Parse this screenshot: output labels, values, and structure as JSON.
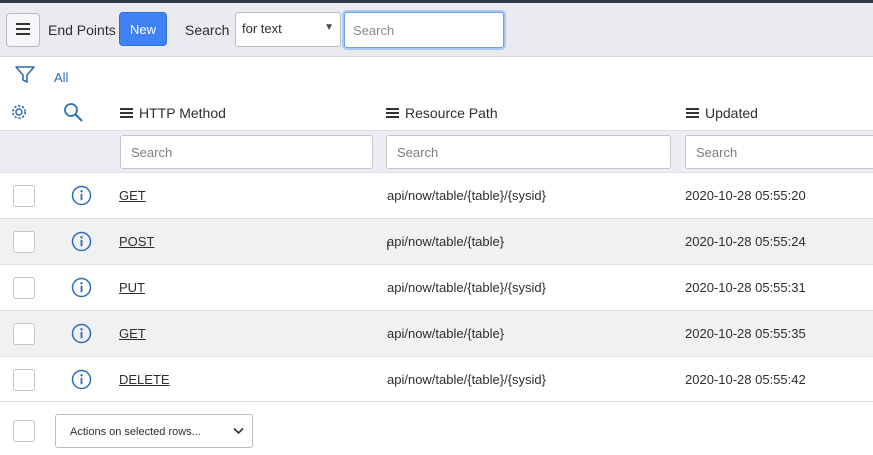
{
  "header": {
    "title": "End Points",
    "new_label": "New",
    "search_label": "Search",
    "search_field": {
      "selected": "for text"
    },
    "search_input": {
      "placeholder": "Search",
      "value": ""
    }
  },
  "filter": {
    "breadcrumb": "All"
  },
  "columns": [
    {
      "label": "HTTP Method",
      "search_placeholder": "Search"
    },
    {
      "label": "Resource Path",
      "search_placeholder": "Search"
    },
    {
      "label": "Updated",
      "search_placeholder": "Search"
    }
  ],
  "rows": [
    {
      "method": "GET",
      "path": "api/now/table/{table}/{sysid}",
      "updated": "2020-10-28 05:55:20"
    },
    {
      "method": "POST",
      "path": "api/now/table/{table}",
      "updated": "2020-10-28 05:55:24"
    },
    {
      "method": "PUT",
      "path": "api/now/table/{table}/{sysid}",
      "updated": "2020-10-28 05:55:31"
    },
    {
      "method": "GET",
      "path": "api/now/table/{table}",
      "updated": "2020-10-28 05:55:35"
    },
    {
      "method": "DELETE",
      "path": "api/now/table/{table}/{sysid}",
      "updated": "2020-10-28 05:55:42"
    }
  ],
  "footer": {
    "actions_label": "Actions on selected rows..."
  },
  "icons": {
    "menu": "hamburger-icon",
    "filter": "funnel-icon",
    "personalize": "gear-icon",
    "search": "magnifier-icon",
    "info": "info-circle-icon",
    "dropdown": "chevron-down-icon"
  },
  "colors": {
    "accent": "#3f82f5",
    "link": "#2a6db7",
    "icon_blue": "#2a6db7"
  }
}
